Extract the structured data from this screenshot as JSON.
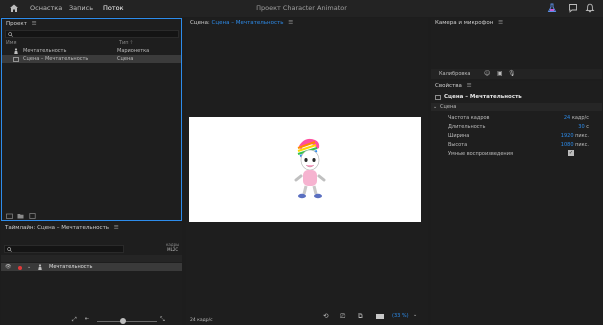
{
  "topbar": {
    "tabs": [
      "Оснастка",
      "Запись",
      "Поток"
    ],
    "active_tab": "Поток",
    "title": "Проект Character Animator"
  },
  "project": {
    "header": "Проект",
    "col_name": "Имя",
    "col_type": "Тип",
    "items": [
      {
        "name": "Мечтательность",
        "type": "Марионетка"
      },
      {
        "name": "Сцена – Мечтательность",
        "type": "Сцена"
      }
    ]
  },
  "scene": {
    "header_prefix": "Сцена:",
    "header_name": "Сцена – Мечтательность",
    "frame_label": "24 кадр/с",
    "zoom": "(33 %)"
  },
  "camera": {
    "header": "Камера и микрофон",
    "calibrate": "Калибровка"
  },
  "properties": {
    "header": "Свойства",
    "title": "Сцена – Мечтательность",
    "section": "Сцена",
    "rows": [
      {
        "label": "Частота кадров",
        "value": "24",
        "unit": "кадр/с"
      },
      {
        "label": "Длительность",
        "value": "30",
        "unit": "с"
      },
      {
        "label": "Ширина",
        "value": "1920",
        "unit": "пикс."
      },
      {
        "label": "Высота",
        "value": "1080",
        "unit": "пикс."
      }
    ],
    "smart_replay": "Умные воспроизведения"
  },
  "timeline": {
    "header": "Таймлайн: Сцена – Мечтательность",
    "frames_label": "кадры",
    "frames_value": "ML2C",
    "track": "Мечтательность"
  }
}
